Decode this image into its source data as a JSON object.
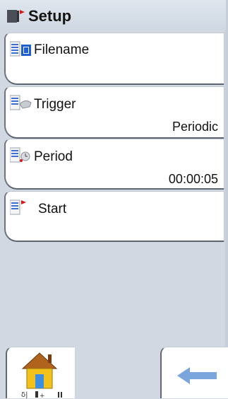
{
  "header": {
    "title": "Setup"
  },
  "items": [
    {
      "label": "Filename",
      "value": ""
    },
    {
      "label": "Trigger",
      "value": "Periodic"
    },
    {
      "label": "Period",
      "value": "00:00:05"
    },
    {
      "label": "Start",
      "value": ""
    }
  ],
  "icons": {
    "header": "setup-flag-icon",
    "filename": "filename-document-icon",
    "trigger": "trigger-hand-icon",
    "period": "period-clock-icon",
    "start": "start-flag-icon",
    "home": "home-icon",
    "back": "back-arrow-icon"
  },
  "colors": {
    "accent_red": "#d81818",
    "arrow_blue": "#7aa6dd",
    "background": "#d2d9e3"
  }
}
